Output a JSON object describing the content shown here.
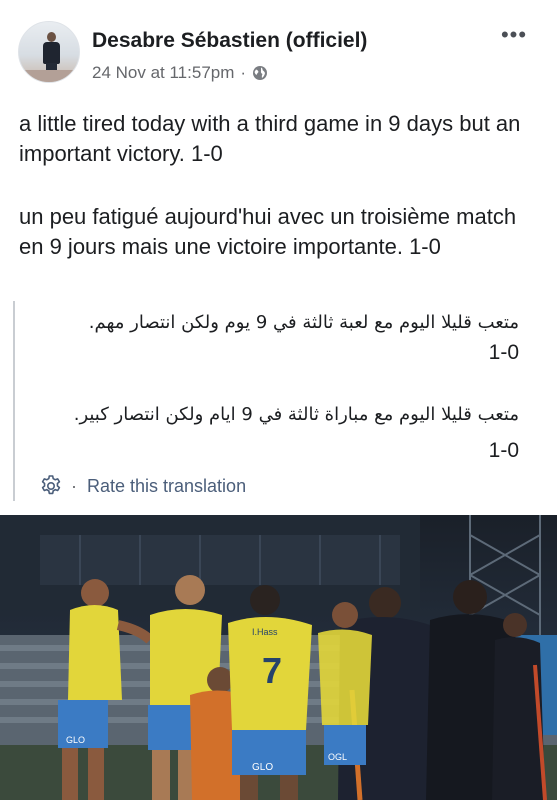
{
  "post": {
    "author": "Desabre Sébastien (officiel)",
    "timestamp": "24 Nov at 11:57pm",
    "separator": "·",
    "privacy_icon": "globe-icon",
    "more_icon": "more-options-icon",
    "more_glyph": "•••",
    "text_en": "a little tired today with a third game in 9 days but an important victory. 1-0",
    "text_fr": "un peu fatigué aujourd'hui avec un troisième match en 9 jours mais une victoire importante. 1-0"
  },
  "translation": {
    "line1": "متعب قليلا اليوم مع لعبة ثالثة في 9 يوم ولكن انتصار مهم.",
    "score1": "1-0",
    "line2": "متعب قليلا اليوم مع مباراة ثالثة في 9 ايام ولكن انتصار كبير.",
    "score2": "1-0",
    "rate_label": "Rate this translation",
    "rate_separator": "·",
    "rate_icon": "gear-icon"
  },
  "photo": {
    "jersey_text_1": "I.Hass",
    "jersey_number": "7",
    "sponsor": "GLO",
    "colors": {
      "jersey_yellow": "#e2d63a",
      "shorts_blue": "#3b7bc4",
      "staff_dark": "#1d2230",
      "night_sky": "#1f2630"
    }
  }
}
